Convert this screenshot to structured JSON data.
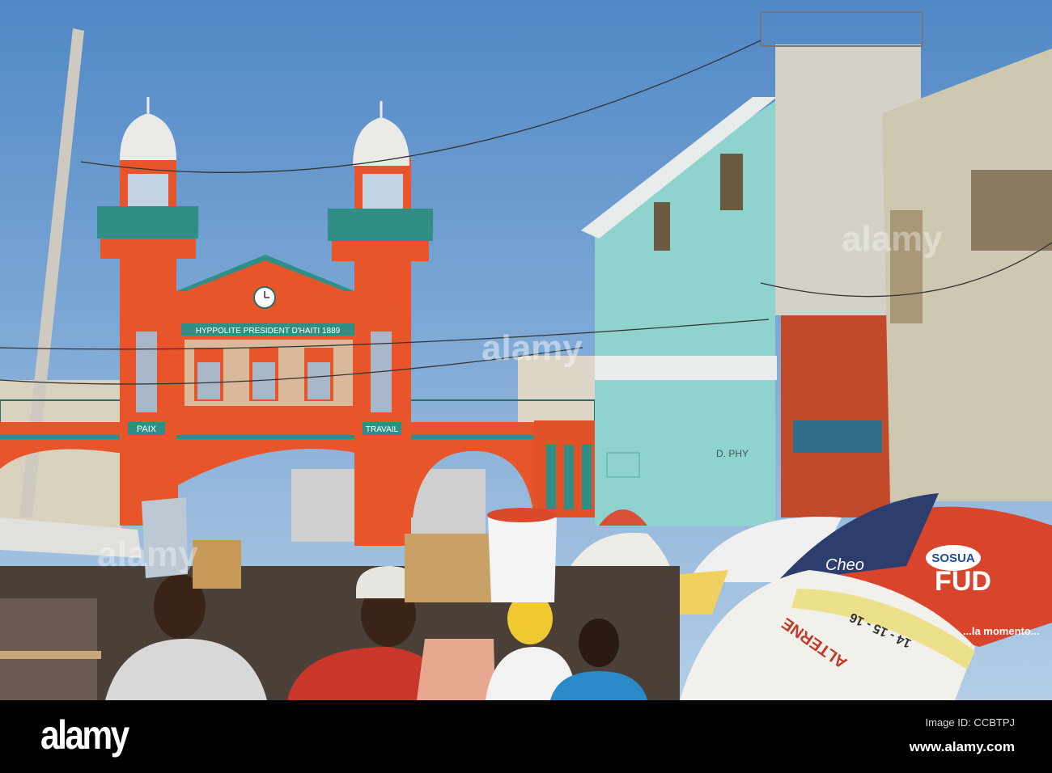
{
  "photo": {
    "plaque": "HYPPOLITE PRESIDENT D'HAITI 1889",
    "left_sign": "PAIX",
    "right_sign": "TRAVAIL",
    "building_sign": "D. PHY",
    "umbrella_brand": "SOSUA",
    "umbrella_product": "FUD",
    "umbrella_side": "Cheo",
    "umbrella_slogan": "...la momento...",
    "umbrella_numbers": "14 - 15 - 16",
    "umbrella_word": "ALTERNE"
  },
  "colors": {
    "sky_top": "#4f88c6",
    "sky_bottom": "#a8c6e4",
    "orange": "#e8552a",
    "teal": "#2f8f86",
    "building": "#8fd3cf"
  },
  "watermark": {
    "logo": "alamy",
    "image_id": "Image ID: CCBTPJ",
    "site": "www.alamy.com"
  }
}
